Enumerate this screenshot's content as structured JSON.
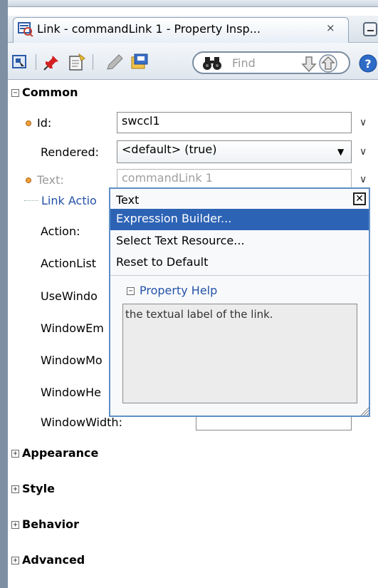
{
  "tab": {
    "title": "Link - commandLink 1 - Property Insp...",
    "close_glyph": "×"
  },
  "toolbar": {
    "find_placeholder": "Find"
  },
  "sections": {
    "common": "Common",
    "appearance": "Appearance",
    "style": "Style",
    "behavior": "Behavior",
    "advanced": "Advanced"
  },
  "props": {
    "id_label": "Id:",
    "id_value": "swccl1",
    "rendered_label": "Rendered:",
    "rendered_value": "<default> (true)",
    "text_label": "Text:",
    "text_value": "commandLink 1",
    "link_action_label": "Link Actio",
    "action_label": "Action:",
    "actionlist_label": "ActionList",
    "usewindow_label": "UseWindo",
    "windowem_label": "WindowEm",
    "windowmo_label": "WindowMo",
    "windowhe_label": "WindowHe",
    "windowwidth_label": "WindowWidth:"
  },
  "popup": {
    "title": "Text",
    "items": [
      "Expression Builder...",
      "Select Text Resource...",
      "Reset to Default"
    ],
    "help_heading": "Property Help",
    "help_text": "the textual label of the link."
  },
  "glyphs": {
    "collapse": "−",
    "expand": "+",
    "chevron": "∨",
    "select_arrow": "▼",
    "close_x": "✕"
  },
  "colors": {
    "selection": "#2d63b5",
    "link_blue": "#2452a8",
    "required_dot": "#f0a23a"
  }
}
